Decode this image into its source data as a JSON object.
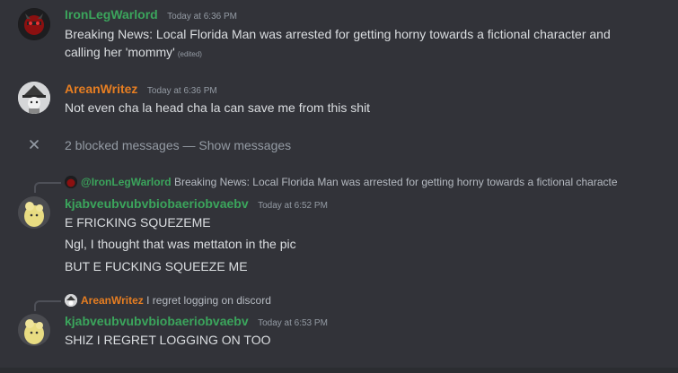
{
  "colors": {
    "background": "#323339",
    "ironleg_name": "#3ba55c",
    "arean_name": "#e67e22",
    "kjab_name": "#3ba55c",
    "text": "#dbdee1",
    "muted": "#949ba4"
  },
  "messages": [
    {
      "author": "IronLegWarlord",
      "timestamp": "Today at 6:36 PM",
      "lines": [
        "Breaking News: Local Florida Man was arrested for getting horny towards a fictional character and",
        "calling her 'mommy'"
      ],
      "edited_tag": "(edited)",
      "avatar_icon": "dark-red-mask-avatar"
    },
    {
      "author": "AreanWritez",
      "timestamp": "Today at 6:36 PM",
      "lines": [
        "Not even cha la head cha la can save me from this shit"
      ],
      "avatar_icon": "grey-wizard-avatar"
    }
  ],
  "blocked": {
    "icon": "close-icon",
    "text": "2 blocked messages",
    "separator": "—",
    "link": "Show messages"
  },
  "replies": [
    {
      "reply_to_name": "@IronLegWarlord",
      "reply_to_text": "Breaking News: Local Florida Man was arrested for getting horny towards a fictional characte",
      "author": "kjabveubvubvbiobaeriobvaebv",
      "timestamp": "Today at 6:52 PM",
      "lines": [
        "E FRICKING SQUEZEME",
        "Ngl, I thought that was mettaton in the pic",
        "BUT E FUCKING SQUEEZE ME"
      ]
    },
    {
      "reply_to_name": "AreanWritez",
      "reply_to_text": "I regret logging on discord",
      "author": "kjabveubvubvbiobaeriobvaebv",
      "timestamp": "Today at 6:53 PM",
      "lines": [
        "SHIZ I REGRET LOGGING ON TOO"
      ]
    }
  ]
}
